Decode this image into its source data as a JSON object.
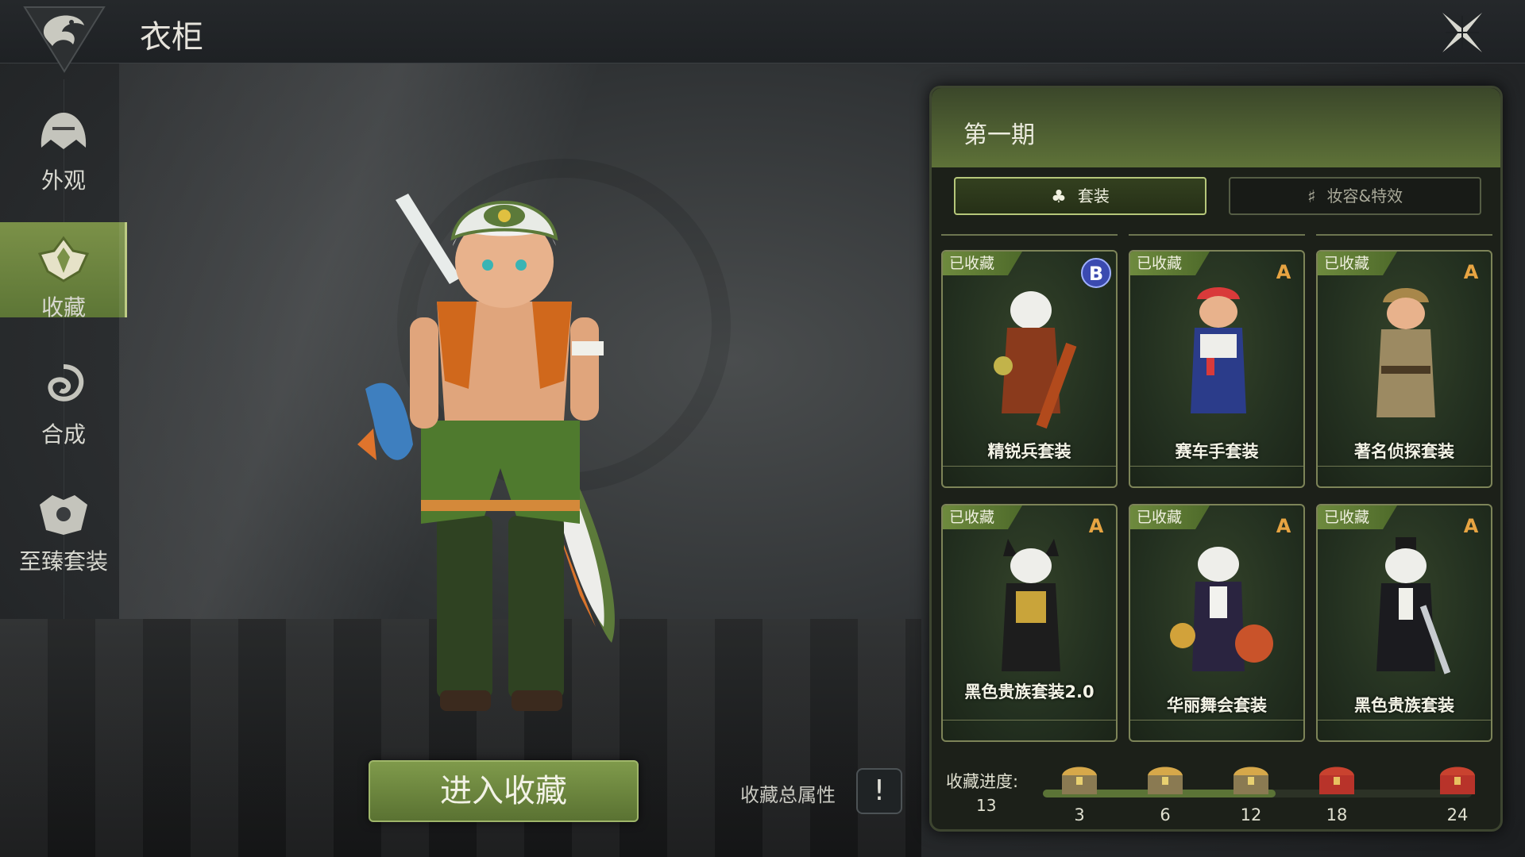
{
  "header": {
    "title": "衣柜"
  },
  "nav": {
    "items": [
      {
        "label": "外观",
        "icon": "helmet-icon"
      },
      {
        "label": "收藏",
        "icon": "collection-icon",
        "active": true
      },
      {
        "label": "合成",
        "icon": "synthesis-icon"
      },
      {
        "label": "至臻套装",
        "icon": "supreme-set-icon"
      }
    ]
  },
  "stage": {
    "enter_button": "进入收藏",
    "attributes_label": "收藏总属性",
    "attributes_icon": "!"
  },
  "panel": {
    "title": "第一期",
    "tabs": [
      {
        "label": "套装",
        "icon": "outfit-icon",
        "active": true
      },
      {
        "label": "妆容&特效",
        "icon": "makeup-icon",
        "active": false
      }
    ],
    "cards": [
      {
        "status": "已收藏",
        "grade": "B",
        "name": "精锐兵套装"
      },
      {
        "status": "已收藏",
        "grade": "A",
        "name": "赛车手套装"
      },
      {
        "status": "已收藏",
        "grade": "A",
        "name": "著名侦探套装"
      },
      {
        "status": "已收藏",
        "grade": "A",
        "name": "黑色贵族套装2.0"
      },
      {
        "status": "已收藏",
        "grade": "A",
        "name": "华丽舞会套装"
      },
      {
        "status": "已收藏",
        "grade": "A",
        "name": "黑色贵族套装"
      }
    ],
    "progress": {
      "label": "收藏进度:",
      "current": "13",
      "max": 24,
      "milestones": [
        "3",
        "6",
        "12",
        "18",
        "24"
      ]
    }
  },
  "colors": {
    "accent_green": "#6e8a3e",
    "grade_b": "#3b4ab0",
    "grade_a": "#e7a442",
    "chest_red": "#b8332a",
    "chest_gold": "#d6a84a"
  }
}
